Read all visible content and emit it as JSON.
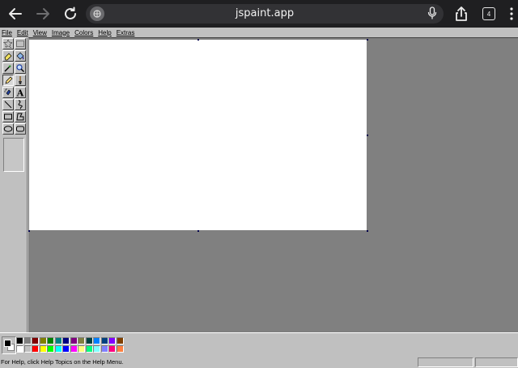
{
  "browser": {
    "url": "jspaint.app",
    "tab_count": "4"
  },
  "menu": {
    "items": [
      "File",
      "Edit",
      "View",
      "Image",
      "Colors",
      "Help",
      "Extras"
    ]
  },
  "tools": [
    {
      "name": "free-form-select",
      "icon": "star-select-icon"
    },
    {
      "name": "select",
      "icon": "rect-select-icon"
    },
    {
      "name": "eraser",
      "icon": "eraser-icon"
    },
    {
      "name": "fill-with-color",
      "icon": "paint-bucket-icon"
    },
    {
      "name": "pick-color",
      "icon": "eyedropper-icon"
    },
    {
      "name": "magnifier",
      "icon": "magnifier-icon"
    },
    {
      "name": "pencil",
      "icon": "pencil-icon",
      "active": true
    },
    {
      "name": "brush",
      "icon": "brush-icon"
    },
    {
      "name": "airbrush",
      "icon": "airbrush-icon"
    },
    {
      "name": "text",
      "icon": "text-icon"
    },
    {
      "name": "line",
      "icon": "line-icon"
    },
    {
      "name": "curve",
      "icon": "curve-icon"
    },
    {
      "name": "rectangle",
      "icon": "rectangle-icon"
    },
    {
      "name": "polygon",
      "icon": "polygon-icon"
    },
    {
      "name": "ellipse",
      "icon": "ellipse-icon"
    },
    {
      "name": "rounded-rectangle",
      "icon": "rounded-rectangle-icon"
    }
  ],
  "colors": {
    "foreground": "#000000",
    "background": "#ffffff",
    "palette": [
      "#000000",
      "#808080",
      "#800000",
      "#808000",
      "#008000",
      "#008080",
      "#000080",
      "#800080",
      "#808040",
      "#004040",
      "#0080ff",
      "#004080",
      "#8000ff",
      "#804000",
      "#ffffff",
      "#c0c0c0",
      "#ff0000",
      "#ffff00",
      "#00ff00",
      "#00ffff",
      "#0000ff",
      "#ff00ff",
      "#ffff80",
      "#00ff80",
      "#80ffff",
      "#8080ff",
      "#ff0080",
      "#ff8040"
    ]
  },
  "status": {
    "help_text": "For Help, click Help Topics on the Help Menu."
  }
}
